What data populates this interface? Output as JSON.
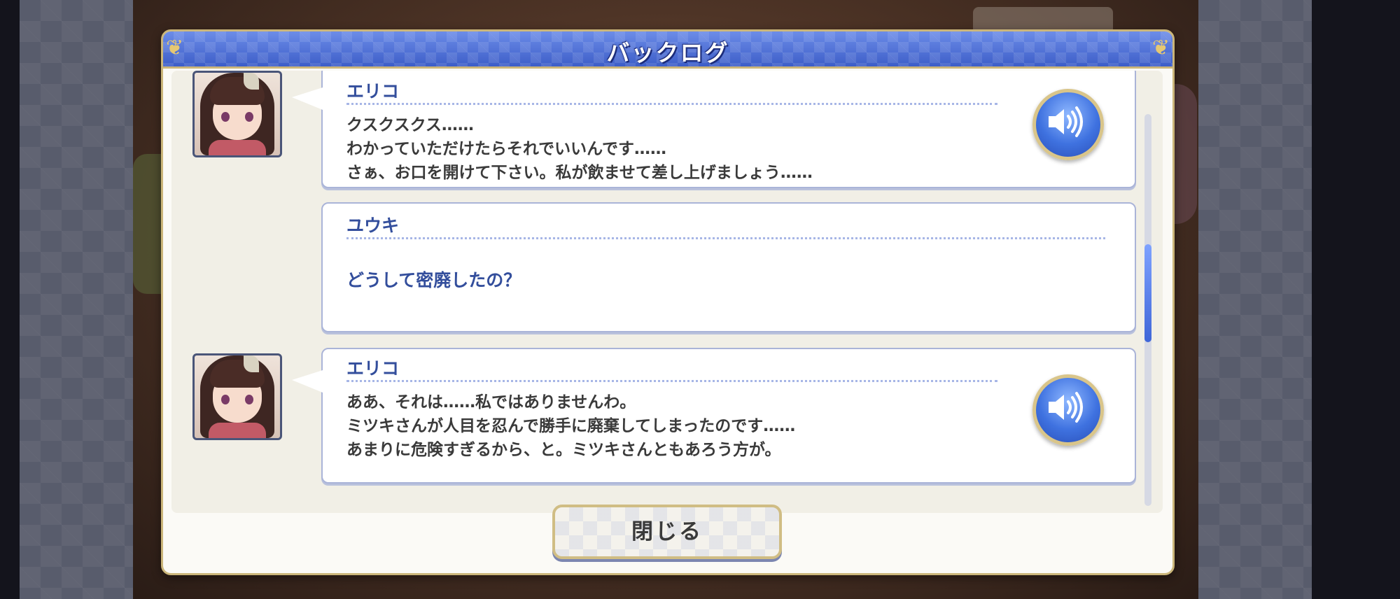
{
  "window": {
    "title": "バックログ"
  },
  "entries": [
    {
      "speaker": "エリコ",
      "lines": [
        "クスクスクス……",
        "わかっていただけたらそれでいいんです……",
        "さぁ、お口を開けて下さい。私が飲ませて差し上げましょう……"
      ],
      "has_voice": true
    },
    {
      "speaker": "ユウキ",
      "lines": [
        "どうして密廃したの？"
      ],
      "has_voice": false
    },
    {
      "speaker": "エリコ",
      "lines": [
        "ああ、それは……私ではありませんわ。",
        "ミツキさんが人目を忍んで勝手に廃棄してしまったのです……",
        "あまりに危険すぎるから、と。ミツキさんともあろう方が。"
      ],
      "has_voice": true
    }
  ],
  "footer": {
    "close_label": "閉じる"
  },
  "icons": {
    "voice": "speaker-volume-icon",
    "portrait": "character-portrait"
  },
  "colors": {
    "title_bar": "#4a6ad8",
    "speaker_name": "#334e9c",
    "frame_gold": "#cbb67a",
    "voice_button": "#3f72e0"
  }
}
